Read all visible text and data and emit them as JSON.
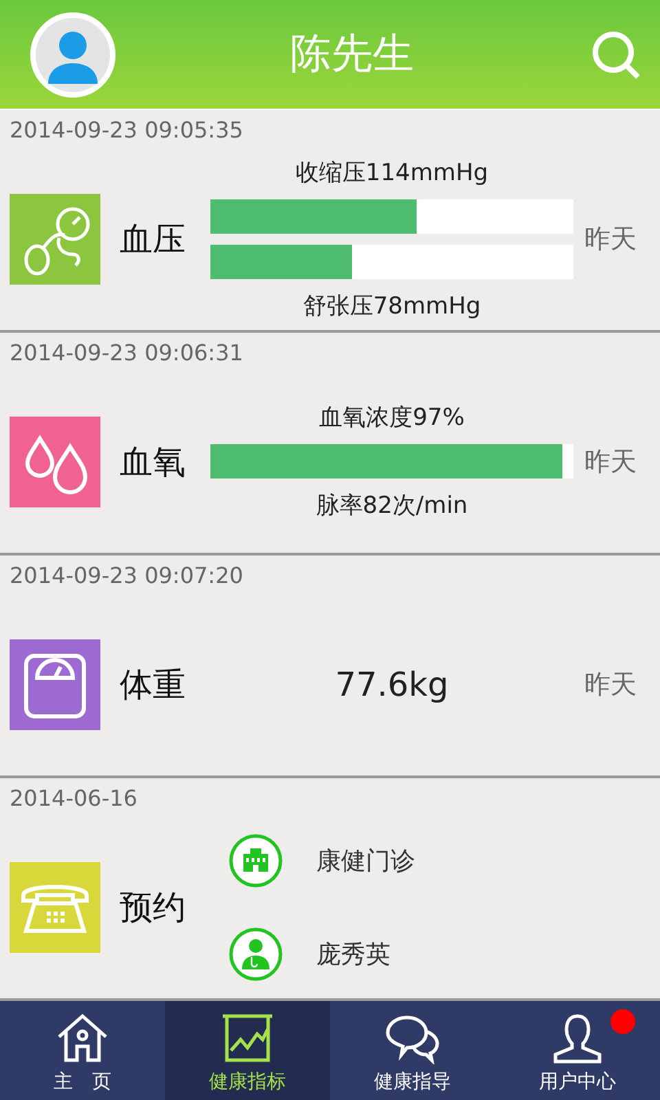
{
  "header": {
    "title": "陈先生"
  },
  "records": [
    {
      "kind": "readings",
      "color": "#8cc63f",
      "timestamp": "2014-09-23 09:05:35",
      "label": "血压",
      "day": "昨天",
      "lines": [
        {
          "kind": "text",
          "text": "收缩压114mmHg"
        },
        {
          "kind": "bar",
          "level": 0.57
        },
        {
          "kind": "bar",
          "level": 0.39
        },
        {
          "kind": "text",
          "text": "舒张压78mmHg"
        }
      ]
    },
    {
      "kind": "readings",
      "color": "#f06292",
      "timestamp": "2014-09-23 09:06:31",
      "label": "血氧",
      "day": "昨天",
      "lines": [
        {
          "kind": "text",
          "text": "血氧浓度97%"
        },
        {
          "kind": "bar",
          "level": 0.97
        },
        {
          "kind": "text",
          "text": "脉率82次/min"
        }
      ]
    },
    {
      "kind": "value",
      "color": "#9c6ad0",
      "timestamp": "2014-09-23 09:07:20",
      "label": "体重",
      "day": "昨天",
      "value": "77.6kg"
    },
    {
      "kind": "contacts",
      "color": "#d8d83a",
      "timestamp": "2014-06-16",
      "label": "预约",
      "contacts": [
        {
          "kind": "clinic",
          "name": "康健门诊"
        },
        {
          "kind": "doctor",
          "name": "庞秀英"
        }
      ]
    }
  ],
  "tabs": [
    {
      "label": "主　页",
      "selected": false,
      "notification": false
    },
    {
      "label": "健康指标",
      "selected": true,
      "notification": false
    },
    {
      "label": "健康指导",
      "selected": false,
      "notification": false
    },
    {
      "label": "用户中心",
      "selected": false,
      "notification": true
    }
  ]
}
